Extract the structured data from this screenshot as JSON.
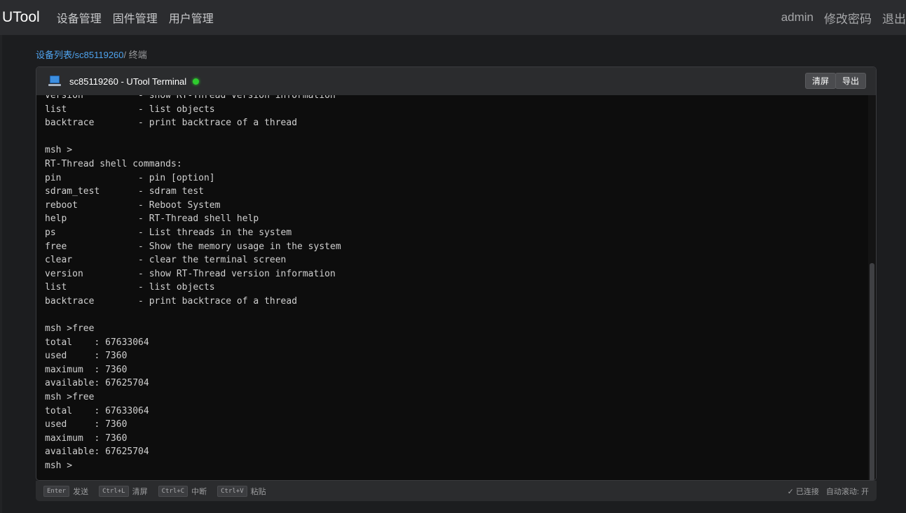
{
  "app": {
    "brand": "UTool",
    "nav": [
      "设备管理",
      "固件管理",
      "用户管理"
    ],
    "user": "admin",
    "change_password": "修改密码",
    "logout": "退出"
  },
  "breadcrumb": {
    "device_list": "设备列表",
    "sep1": "/",
    "device": "sc85119260",
    "sep2": "/ ",
    "current": "终端"
  },
  "terminal": {
    "title": "sc85119260 - UTool Terminal",
    "status_color": "#2ecc2e",
    "clear_label": "清屏",
    "export_label": "导出",
    "lines": [
      "version          - show RT-Thread version information",
      "list             - list objects",
      "backtrace        - print backtrace of a thread",
      "",
      "msh >",
      "RT-Thread shell commands:",
      "pin              - pin [option]",
      "sdram_test       - sdram test",
      "reboot           - Reboot System",
      "help             - RT-Thread shell help",
      "ps               - List threads in the system",
      "free             - Show the memory usage in the system",
      "clear            - clear the terminal screen",
      "version          - show RT-Thread version information",
      "list             - list objects",
      "backtrace        - print backtrace of a thread",
      "",
      "msh >free",
      "total    : 67633064",
      "used     : 7360",
      "maximum  : 7360",
      "available: 67625704",
      "msh >free",
      "total    : 67633064",
      "used     : 7360",
      "maximum  : 7360",
      "available: 67625704",
      "msh >"
    ]
  },
  "footer": {
    "hints": [
      {
        "key": "Enter",
        "label": "发送"
      },
      {
        "key": "Ctrl+L",
        "label": "清屏"
      },
      {
        "key": "Ctrl+C",
        "label": "中断"
      },
      {
        "key": "Ctrl+V",
        "label": "粘贴"
      }
    ],
    "connected": "✓ 已连接",
    "autoscroll": "自动滚动: 开"
  }
}
